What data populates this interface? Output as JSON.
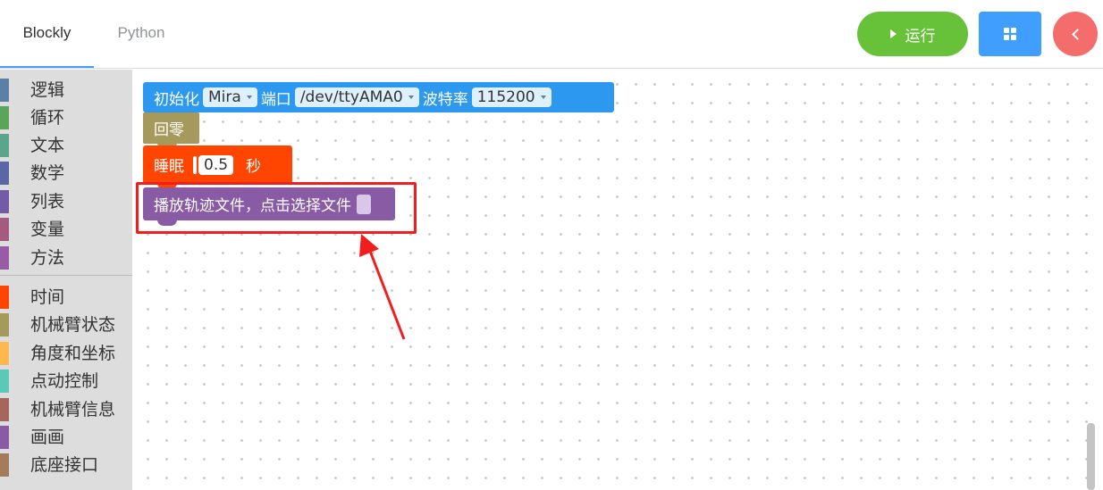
{
  "tabs": {
    "blockly": "Blockly",
    "python": "Python"
  },
  "actions": {
    "run_label": "运行"
  },
  "toolbox": {
    "categories": [
      {
        "label": "逻辑",
        "color": "#5b80a5"
      },
      {
        "label": "循环",
        "color": "#5ba55b"
      },
      {
        "label": "文本",
        "color": "#5ba58c"
      },
      {
        "label": "数学",
        "color": "#5b67a5"
      },
      {
        "label": "列表",
        "color": "#745ba5"
      },
      {
        "label": "变量",
        "color": "#a55b80"
      },
      {
        "label": "方法",
        "color": "#995ba5"
      },
      {
        "label": "时间",
        "color": "#ff4500"
      },
      {
        "label": "机械臂状态",
        "color": "#a59a5b"
      },
      {
        "label": "角度和坐标",
        "color": "#ffb84d"
      },
      {
        "label": "点动控制",
        "color": "#5bc8b8"
      },
      {
        "label": "机械臂信息",
        "color": "#a5665b"
      },
      {
        "label": "画画",
        "color": "#8a5ba5"
      },
      {
        "label": "底座接口",
        "color": "#a57c5b"
      }
    ]
  },
  "blocks": {
    "init": {
      "label": "初始化",
      "robot": "Mira",
      "port_label": "端口",
      "port": "/dev/ttyAMA0",
      "baud_label": "波特率",
      "baud": "115200",
      "color": "#2c98f0"
    },
    "home": {
      "label": "回零",
      "color": "#a59a5b"
    },
    "sleep": {
      "label": "睡眠",
      "value": "0.5",
      "unit": "秒",
      "color": "#ff4500"
    },
    "play": {
      "label": "播放轨迹文件，点击选择文件",
      "color": "#8a5ba5"
    }
  }
}
